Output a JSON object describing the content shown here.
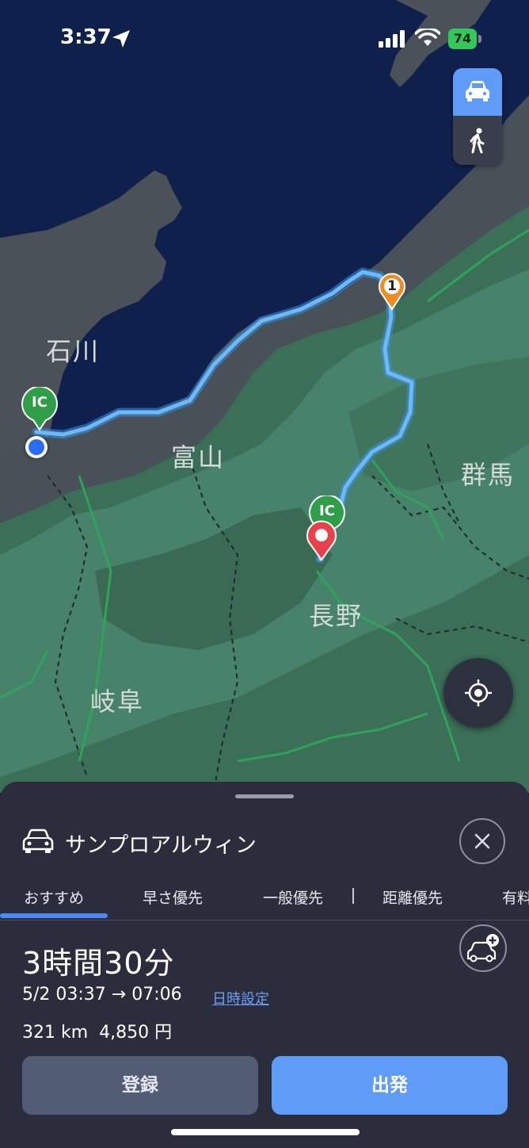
{
  "status_bar": {
    "time": "3:37",
    "battery": "74"
  },
  "map": {
    "labels": {
      "ishikawa": "石川",
      "toyama": "富山",
      "gunma": "群馬",
      "nagano": "長野",
      "gifu": "岐阜"
    },
    "markers": {
      "ic_label": "IC",
      "waypoint_number": "1"
    },
    "mode_toggle": {
      "selected": "car",
      "icons": [
        "car-icon",
        "walk-icon"
      ]
    }
  },
  "sheet": {
    "destination": "サンプロアルウィン",
    "tabs": [
      "おすすめ",
      "早さ優先",
      "一般優先",
      "距離優先",
      "有料"
    ],
    "selected_tab": "おすすめ",
    "duration": "3時間30分",
    "schedule": "5/2 03:37 → 07:06",
    "schedule_link": "日時設定",
    "distance_fare": "321 km  4,850 円",
    "buttons": {
      "register": "登録",
      "depart": "出発"
    }
  },
  "colors": {
    "route": "#5aaef5",
    "accent": "#5e9cf7",
    "ic_marker": "#2e9e48",
    "waypoint": "#f08c24",
    "destination_pin": "#e9414b",
    "sheet_bg": "#2b2d3c"
  }
}
